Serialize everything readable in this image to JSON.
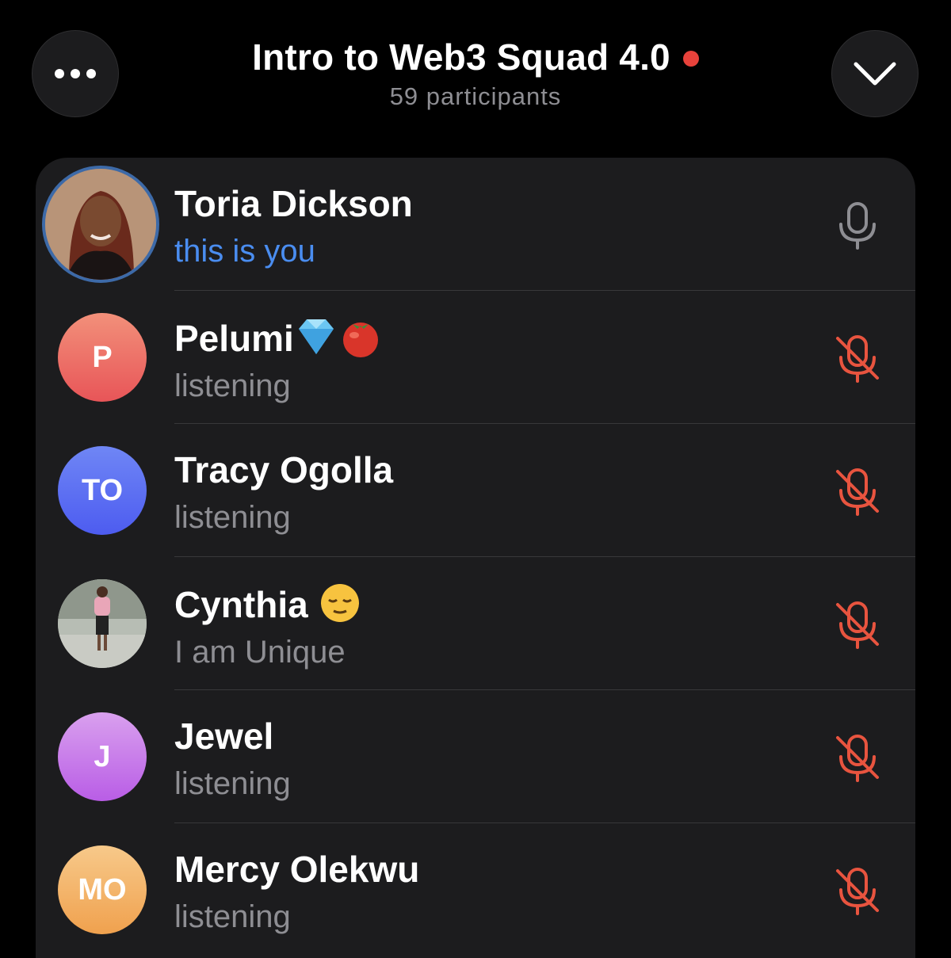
{
  "header": {
    "title": "Intro to Web3 Squad 4.0",
    "participants": "59 participants",
    "live_color": "#e8423b"
  },
  "buttons": {
    "more_icon": "more-horizontal-icon",
    "collapse_icon": "chevron-down-icon"
  },
  "colors": {
    "accent_blue": "#4a8df0",
    "muted_red": "#e8543f",
    "mic_gray": "#8e8e93"
  },
  "participants": [
    {
      "name": "Toria Dickson",
      "status": "this is you",
      "initials": "",
      "avatar_type": "photo",
      "mic": "available"
    },
    {
      "name": "Pelumi",
      "status": "listening",
      "initials": "P",
      "avatar_type": "initials",
      "emojis": [
        "gem-stone",
        "tomato"
      ],
      "mic": "muted"
    },
    {
      "name": "Tracy Ogolla",
      "status": "listening",
      "initials": "TO",
      "avatar_type": "initials",
      "mic": "muted"
    },
    {
      "name": "Cynthia",
      "status": "I am Unique",
      "initials": "",
      "avatar_type": "photo",
      "emojis": [
        "relieved-face"
      ],
      "mic": "muted"
    },
    {
      "name": "Jewel",
      "status": "listening",
      "initials": "J",
      "avatar_type": "initials",
      "mic": "muted"
    },
    {
      "name": "Mercy Olekwu",
      "status": "listening",
      "initials": "MO",
      "avatar_type": "initials",
      "mic": "muted"
    }
  ]
}
